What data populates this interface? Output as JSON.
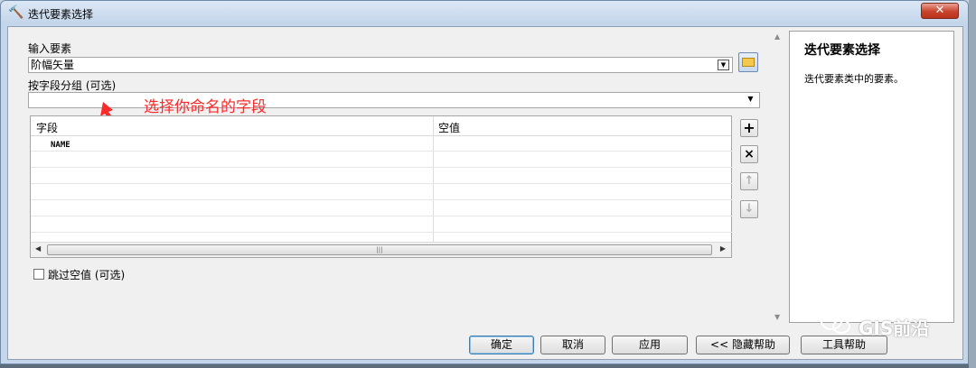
{
  "window": {
    "title": "迭代要素选择",
    "close_label": "✕"
  },
  "form": {
    "input_label": "输入要素",
    "input_value": "阶幅矢量",
    "group_label": "按字段分组 (可选)",
    "group_value": "",
    "grid": {
      "columns": [
        "字段",
        "空值"
      ],
      "rows": [
        [
          "NAME",
          ""
        ]
      ]
    },
    "skip_null_label": "跳过空值 (可选)"
  },
  "annotation": {
    "text": "选择你命名的字段",
    "color": "#ff2a2a"
  },
  "side_buttons": {
    "add": "+",
    "remove": "×",
    "up": "↑",
    "down": "↓"
  },
  "help": {
    "title": "迭代要素选择",
    "body": "迭代要素类中的要素。"
  },
  "buttons": {
    "ok": "确定",
    "cancel": "取消",
    "apply": "应用",
    "hide_help": "<< 隐藏帮助",
    "tool_help": "工具帮助"
  },
  "watermark": {
    "text": "GIS前沿"
  }
}
